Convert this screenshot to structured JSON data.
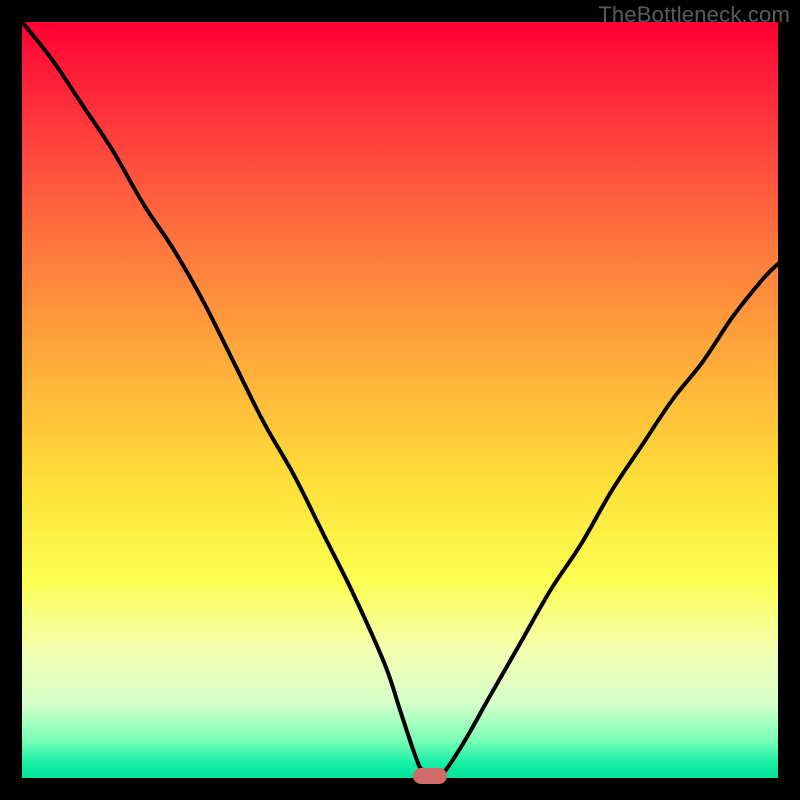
{
  "watermark": "TheBottleneck.com",
  "colors": {
    "frame": "#000000",
    "curve": "#000000",
    "marker": "#d26a6a",
    "gradient_top": "#ff0033",
    "gradient_bottom": "#00e29a"
  },
  "chart_data": {
    "type": "line",
    "title": "",
    "xlabel": "",
    "ylabel": "",
    "xlim": [
      0,
      100
    ],
    "ylim": [
      0,
      100
    ],
    "legend": false,
    "grid": false,
    "series": [
      {
        "name": "bottleneck-curve",
        "x": [
          0,
          4,
          8,
          12,
          16,
          20,
          24,
          28,
          32,
          36,
          40,
          44,
          48,
          50,
          52,
          53,
          55,
          58,
          62,
          66,
          70,
          74,
          78,
          82,
          86,
          90,
          94,
          98,
          100
        ],
        "values": [
          100,
          95,
          89,
          83,
          76,
          70,
          63,
          55,
          47,
          40,
          32,
          24,
          15,
          9,
          3,
          1,
          0,
          4,
          11,
          18,
          25,
          31,
          38,
          44,
          50,
          55,
          61,
          66,
          68
        ]
      }
    ],
    "marker": {
      "x": 54,
      "y": 0,
      "label": "optimal-point"
    }
  }
}
